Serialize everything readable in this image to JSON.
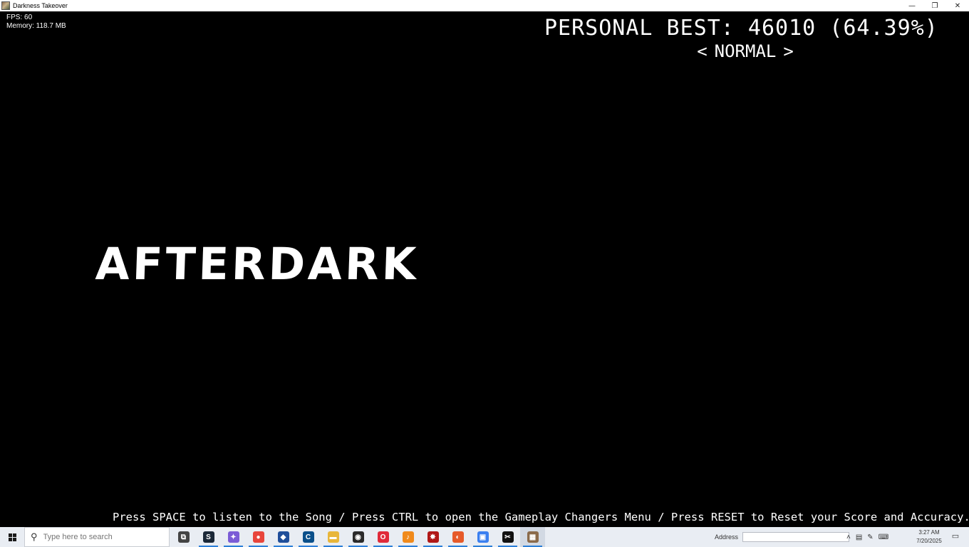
{
  "window": {
    "title": "Darkness Takeover",
    "minimize_icon": "minimize-icon",
    "restore_icon": "restore-icon",
    "close_icon": "close-icon"
  },
  "debug": {
    "fps": "FPS: 60",
    "memory": "Memory: 118.7 MB"
  },
  "score": {
    "personal_best": "PERSONAL BEST: 46010 (64.39%)",
    "difficulty": "NORMAL",
    "left_arrow": "<",
    "right_arrow": ">"
  },
  "song": {
    "title": "AFTERDARK"
  },
  "hint": "Press SPACE to listen to the Song / Press CTRL to open the Gameplay Changers Menu / Press RESET to Reset your Score and Accuracy.",
  "taskbar": {
    "search_placeholder": "Type here to search",
    "apps": [
      {
        "name": "task-view-icon",
        "color": "#444444",
        "glyph": "⧉"
      },
      {
        "name": "steam-icon",
        "color": "#1b2838",
        "glyph": "S"
      },
      {
        "name": "copilot-icon",
        "color": "#7b5cd6",
        "glyph": "✦"
      },
      {
        "name": "chrome-icon",
        "color": "#e8453c",
        "glyph": "●"
      },
      {
        "name": "shield-app-icon",
        "color": "#1f4e9a",
        "glyph": "◆"
      },
      {
        "name": "c-app-icon",
        "color": "#0a4f8a",
        "glyph": "C"
      },
      {
        "name": "file-explorer-icon",
        "color": "#e8b63a",
        "glyph": "▬"
      },
      {
        "name": "obs-icon",
        "color": "#2a2a2a",
        "glyph": "◉"
      },
      {
        "name": "opera-icon",
        "color": "#e02a3a",
        "glyph": "O"
      },
      {
        "name": "fl-studio-icon",
        "color": "#f08a1c",
        "glyph": "♪"
      },
      {
        "name": "red-app-icon",
        "color": "#b01818",
        "glyph": "✸"
      },
      {
        "name": "firefox-icon",
        "color": "#e65a2a",
        "glyph": "◐"
      },
      {
        "name": "blue-app-icon",
        "color": "#3a7ff0",
        "glyph": "▣"
      },
      {
        "name": "capcut-icon",
        "color": "#111111",
        "glyph": "✂"
      },
      {
        "name": "game-app-icon",
        "color": "#8a6a4a",
        "glyph": "▦"
      }
    ],
    "address_label": "Address",
    "time": "3:27 AM",
    "date": "7/20/2025"
  }
}
